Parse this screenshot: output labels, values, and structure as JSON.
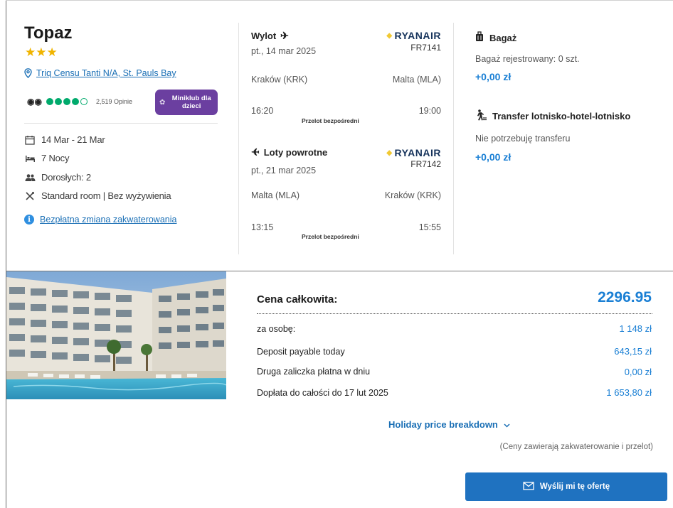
{
  "hotel": {
    "name": "Topaz",
    "stars": "★★★",
    "address": "Triq Censu Tanti N/A, St. Pauls Bay",
    "tripadvisor_reviews": "2,519 Opinie",
    "rating_bubbles": 4,
    "badge": "Miniklub dla dzieci",
    "dates": "14 Mar - 21 Mar",
    "nights": "7 Nocy",
    "guests": "Dorosłych: 2",
    "board": "Standard room | Bez wyżywienia",
    "free_change": "Bezpłatna zmiana zakwaterowania"
  },
  "outbound": {
    "heading": "Wylot",
    "date": "pt., 14 mar 2025",
    "airline": "RYANAIR",
    "flight_no": "FR7141",
    "from": "Kraków (KRK)",
    "to": "Malta (MLA)",
    "depart": "16:20",
    "arrive": "19:00",
    "type": "Przelot bezpośredni"
  },
  "inbound": {
    "heading": "Loty powrotne",
    "date": "pt., 21 mar 2025",
    "airline": "RYANAIR",
    "flight_no": "FR7142",
    "from": "Malta (MLA)",
    "to": "Kraków (KRK)",
    "depart": "13:15",
    "arrive": "15:55",
    "type": "Przelot bezpośredni"
  },
  "baggage": {
    "heading": "Bagaż",
    "detail": "Bagaż rejestrowany: 0 szt.",
    "price": "+0,00 zł"
  },
  "transfer": {
    "heading": "Transfer lotnisko-hotel-lotnisko",
    "detail": "Nie potrzebuję transferu",
    "price": "+0,00 zł"
  },
  "pricing": {
    "total_label": "Cena całkowita:",
    "total_value": "2296.95",
    "rows": [
      {
        "label": "za osobę:",
        "value": "1 148 zł"
      },
      {
        "label": "Deposit payable today",
        "value": "643,15 zł"
      },
      {
        "label": "Druga zaliczka płatna w dniu",
        "value": "0,00 zł"
      },
      {
        "label": "Dopłata do całości do 17 lut 2025",
        "value": "1 653,80 zł"
      }
    ],
    "breakdown_link": "Holiday price breakdown",
    "note": "(Ceny zawierają zakwaterowanie i przelot)",
    "send_button": "Wyślij mi tę ofertę"
  },
  "colors": {
    "accent_blue": "#1a7fd4",
    "button_blue": "#1f72c0",
    "star_gold": "#f0b400",
    "badge_purple": "#6b3fa0",
    "tripadvisor_green": "#00aa6c"
  }
}
